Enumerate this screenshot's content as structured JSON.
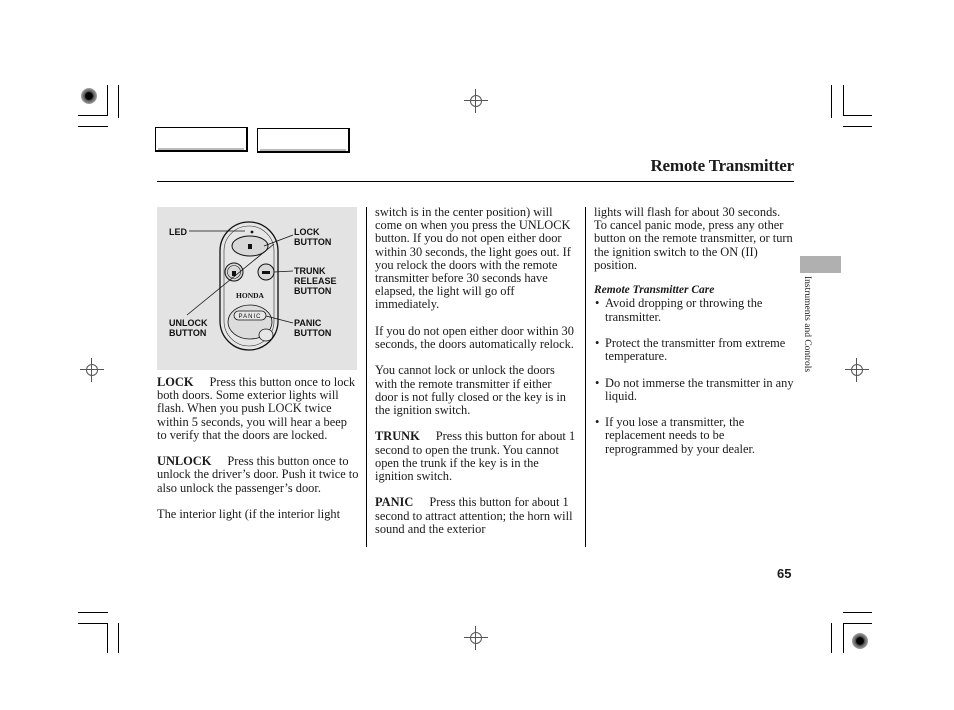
{
  "header": {
    "title": "Remote Transmitter",
    "nav_boxes": [
      "",
      ""
    ]
  },
  "figure": {
    "labels": {
      "led": "LED",
      "lock": [
        "LOCK",
        "BUTTON"
      ],
      "trunk": [
        "TRUNK",
        "RELEASE",
        "BUTTON"
      ],
      "unlock": [
        "UNLOCK",
        "BUTTON"
      ],
      "panic": [
        "PANIC",
        "BUTTON"
      ]
    },
    "brand": "HONDA",
    "panic_key_text": "PANIC"
  },
  "column1": {
    "lock_term": "LOCK",
    "lock_text": "Press this button once to lock both doors. Some exterior lights will flash. When you push LOCK twice within 5 seconds, you will hear a beep to verify that the doors are locked.",
    "unlock_term": "UNLOCK",
    "unlock_text": "Press this button once to unlock the driver’s door. Push it twice to also unlock the passenger’s door.",
    "interior_text": "The interior light (if the interior light"
  },
  "column2": {
    "p1": "switch is in the center position) will come on when you press the UNLOCK button. If you do not open either door within 30 seconds, the light goes out. If you relock the doors with the remote transmitter before 30 seconds have elapsed, the light will go off immediately.",
    "p2": "If you do not open either door within 30 seconds, the doors automatically relock.",
    "p3": "You cannot lock or unlock the doors with the remote transmitter if either door is not fully closed or the key is in the ignition switch.",
    "trunk_term": "TRUNK",
    "trunk_text": "Press this button for about 1 second to open the trunk. You cannot open the trunk if the key is in the ignition switch.",
    "panic_term": "PANIC",
    "panic_text": "Press this button for about 1 second to attract attention; the horn will sound and the exterior"
  },
  "column3": {
    "p1": "lights will flash for about 30 seconds. To cancel panic mode, press any other button on the remote transmitter, or turn the ignition switch to the ON (II) position.",
    "care_heading": "Remote Transmitter Care",
    "care_items": [
      "Avoid dropping or throwing the transmitter.",
      "Protect the transmitter from extreme temperature.",
      "Do not immerse the transmitter in any liquid.",
      "If you lose a transmitter, the replacement needs to be reprogrammed by your dealer."
    ]
  },
  "sidebar": {
    "section_label": "Instruments and Controls"
  },
  "footer": {
    "page_number": "65"
  }
}
